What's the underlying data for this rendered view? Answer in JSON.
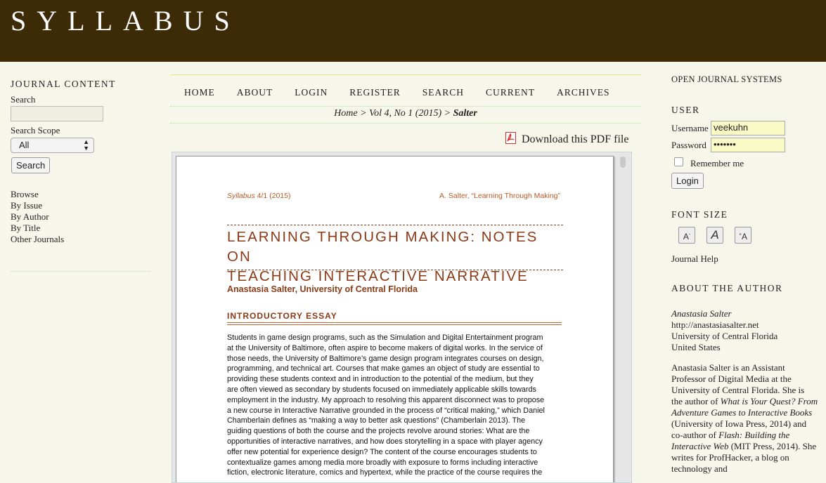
{
  "header": {
    "site_title": "SYLLABUS"
  },
  "left_sidebar": {
    "journal_content_title": "JOURNAL CONTENT",
    "search_label": "Search",
    "search_value": "",
    "scope_label": "Search Scope",
    "scope_value": "All",
    "search_button": "Search",
    "browse_label": "Browse",
    "browse_items": [
      "By Issue",
      "By Author",
      "By Title",
      "Other Journals"
    ]
  },
  "nav": {
    "items": [
      "HOME",
      "ABOUT",
      "LOGIN",
      "REGISTER",
      "SEARCH",
      "CURRENT",
      "ARCHIVES"
    ]
  },
  "breadcrumb": {
    "home": "Home",
    "sep": ">",
    "issue": "Vol 4, No 1 (2015)",
    "current": "Salter"
  },
  "download": {
    "label": "Download this PDF file"
  },
  "pdf": {
    "header_left_italic": "Syllabus",
    "header_left_rest": " 4/1 (2015)",
    "header_right": "A. Salter, “Learning Through Making”",
    "title_line1": "LEARNING THROUGH MAKING: NOTES ON",
    "title_line2": "TEACHING INTERACTIVE NARRATIVE",
    "author": "Anastasia Salter, University of Central Florida",
    "section": "INTRODUCTORY ESSAY",
    "body_lines": [
      "Students in game design programs, such as the Simulation and Digital Entertainment program",
      "at the University of Baltimore, often aspire to become makers of digital works. In the service of",
      "those needs, the University of Baltimore’s game design program integrates courses on design,",
      "programming, and technical art. Courses that make games an object of study are essential to",
      "providing these students context and in introduction to the potential of the medium, but they",
      "are often viewed as secondary by students focused on immediately applicable skills towards",
      "employment in the industry. My approach to resolving this apparent disconnect was to propose",
      "a new course in Interactive Narrative grounded in the process of “critical making,” which Daniel",
      "Chamberlain defines as “making a way to better ask questions” (Chamberlain 2013). The",
      "guiding questions of both the course and the projects revolve around stories: What are the",
      "opportunities of interactive narratives, and how does storytelling in a space with player agency",
      "offer new potential for experience design? The content of the course encourages students to",
      "contextualize games among media more broadly with exposure to forms including interactive",
      "fiction, electronic literature, comics and hypertext, while the practice of the course requires the"
    ]
  },
  "right_sidebar": {
    "ojs_label": "OPEN JOURNAL SYSTEMS",
    "user_title": "USER",
    "username_label": "Username",
    "username_value": "veekuhn",
    "password_label": "Password",
    "password_value": "•••••••",
    "remember_label": "Remember me",
    "login_button": "Login",
    "font_size_title": "FONT SIZE",
    "journal_help": "Journal Help",
    "about_title": "ABOUT THE AUTHOR",
    "author_name": "Anastasia Salter",
    "author_url": "http://anastasiasalter.net",
    "author_affiliation": "University of Central Florida",
    "author_country": "United States",
    "bio_lines": [
      "Anastasia Salter is an Assistant",
      "Professor of Digital Media at the",
      "University of Central Florida. She is",
      "the author of "
    ],
    "bio_book1": "What is Your Quest? From Adventure Games to Interactive Books",
    "bio_mid1": " (University of Iowa Press, 2014) and co-author of ",
    "bio_book2": "Flash: Building the Interactive Web",
    "bio_mid2": " (MIT Press, 2014). She writes for ProfHacker, a blog on technology and"
  }
}
